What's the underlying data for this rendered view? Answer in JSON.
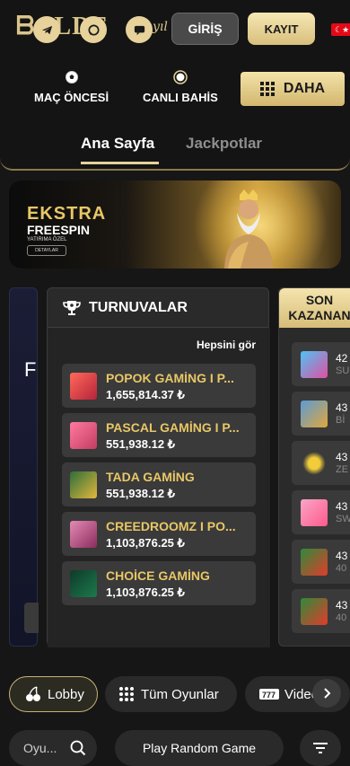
{
  "header": {
    "logo_text": "ᗷALDE",
    "logo_suffix": "yıl",
    "login_label": "GİRİŞ",
    "register_label": "KAYIT",
    "language": "TR",
    "colors": {
      "gold": "#e6d29a",
      "background": "#141414"
    }
  },
  "nav": {
    "items": [
      {
        "label": "MAÇ ÖNCESİ",
        "icon": "soccer-ball-icon"
      },
      {
        "label": "CANLI BAHİS",
        "icon": "live-dot-icon"
      }
    ],
    "more_label": "DAHA",
    "tabs": [
      {
        "label": "Ana Sayfa",
        "active": true
      },
      {
        "label": "Jackpotlar",
        "active": false
      }
    ]
  },
  "banner": {
    "title": "EKSTRA",
    "subtitle": "FREESPIN",
    "small": "YATIRIMA ÖZEL",
    "button": "DETAYLAR"
  },
  "left_panel": {
    "letter": "F"
  },
  "tournaments": {
    "title": "TURNUVALAR",
    "see_all": "Hepsini gör",
    "items": [
      {
        "name": "POPOK GAMİNG I P...",
        "amount": "1,655,814.37 ₺"
      },
      {
        "name": "PASCAL GAMİNG I P...",
        "amount": "551,938.12 ₺"
      },
      {
        "name": "TADA GAMİNG",
        "amount": "551,938.12 ₺"
      },
      {
        "name": "CREEDROOMZ I PO...",
        "amount": "1,103,876.25 ₺"
      },
      {
        "name": "CHOİCE GAMİNG",
        "amount": "1,103,876.25 ₺"
      }
    ]
  },
  "winners": {
    "title_line1": "SON",
    "title_line2": "KAZANAN",
    "items": [
      {
        "a": "42",
        "b": "SU"
      },
      {
        "a": "43",
        "b": "Bİ"
      },
      {
        "a": "43",
        "b": "ZE"
      },
      {
        "a": "43",
        "b": "SW"
      },
      {
        "a": "43",
        "b": "40"
      },
      {
        "a": "43",
        "b": "40"
      }
    ]
  },
  "categories": {
    "lobby": "Lobby",
    "all_games": "Tüm Oyunlar",
    "video": "Video"
  },
  "bottom": {
    "search_placeholder": "Oyu...",
    "random_game": "Play Random Game"
  }
}
